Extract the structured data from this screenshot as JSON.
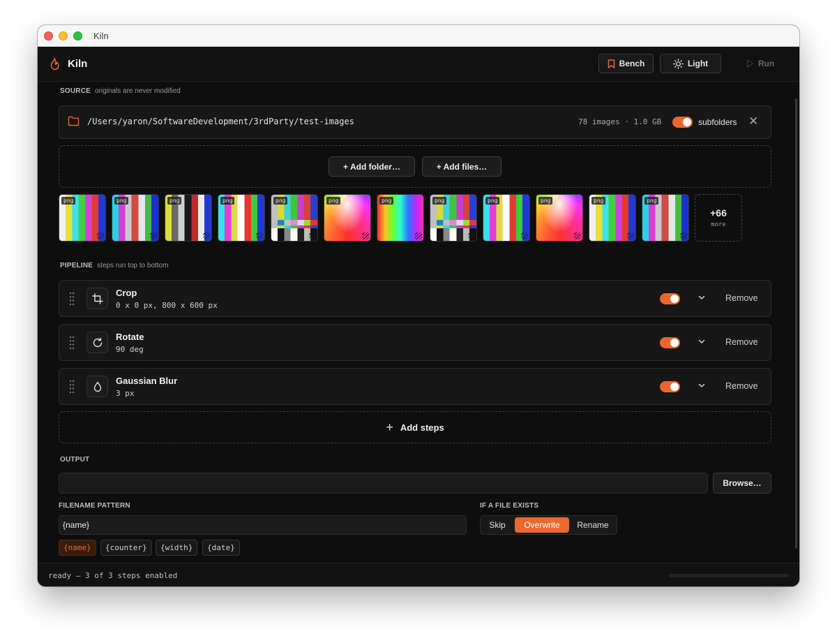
{
  "window": {
    "title": "Kiln"
  },
  "app": {
    "name": "Kiln",
    "bench_label": "Bench",
    "light_label": "Light",
    "run_label": "Run"
  },
  "source": {
    "label": "SOURCE",
    "hint": "originals are never modified",
    "path": "/Users/yaron/SoftwareDevelopment/3rdParty/test-images",
    "stats": "78 images · 1.0 GB",
    "subfolders_label": "subfolders",
    "subfolders_enabled": true,
    "add_folder_label": "+ Add folder…",
    "add_files_label": "+ Add files…",
    "thumbnails": [
      {
        "format": "png",
        "style": "bars7"
      },
      {
        "format": "png",
        "style": "bars7b"
      },
      {
        "format": "png",
        "style": "bars7c"
      },
      {
        "format": "png",
        "style": "bars7d"
      },
      {
        "format": "png",
        "style": "smpte"
      },
      {
        "format": "png",
        "style": "spectrum"
      },
      {
        "format": "png",
        "style": "rainbow"
      },
      {
        "format": "png",
        "style": "smpte"
      },
      {
        "format": "png",
        "style": "bars7d"
      },
      {
        "format": "png",
        "style": "spectrum"
      },
      {
        "format": "png",
        "style": "bars7"
      },
      {
        "format": "png",
        "style": "bars7b"
      }
    ],
    "more_count": "+66",
    "more_label": "more"
  },
  "pipeline": {
    "label": "PIPELINE",
    "hint": "steps run top to bottom",
    "steps": [
      {
        "name": "Crop",
        "params": "0 x 0 px, 800 x 600 px",
        "icon": "crop-icon",
        "enabled": true,
        "remove_label": "Remove"
      },
      {
        "name": "Rotate",
        "params": "90 deg",
        "icon": "rotate-icon",
        "enabled": true,
        "remove_label": "Remove"
      },
      {
        "name": "Gaussian Blur",
        "params": "3 px",
        "icon": "droplet-icon",
        "enabled": true,
        "remove_label": "Remove"
      }
    ],
    "add_steps_label": "Add steps"
  },
  "output": {
    "label": "OUTPUT",
    "path_value": "",
    "browse_label": "Browse…",
    "filename_pattern_label": "FILENAME PATTERN",
    "filename_pattern_value": "{name}",
    "tokens": [
      "{name}",
      "{counter}",
      "{width}",
      "{date}"
    ],
    "active_token": "{name}",
    "if_exists_label": "IF A FILE EXISTS",
    "if_exists_options": [
      "Skip",
      "Overwrite",
      "Rename"
    ],
    "if_exists_selected": "Overwrite"
  },
  "status": {
    "text": "ready — 3 of 3 steps enabled",
    "progress": 0
  },
  "colors": {
    "accent": "#e8682f",
    "background": "#0e0e0e",
    "card": "#171717"
  }
}
